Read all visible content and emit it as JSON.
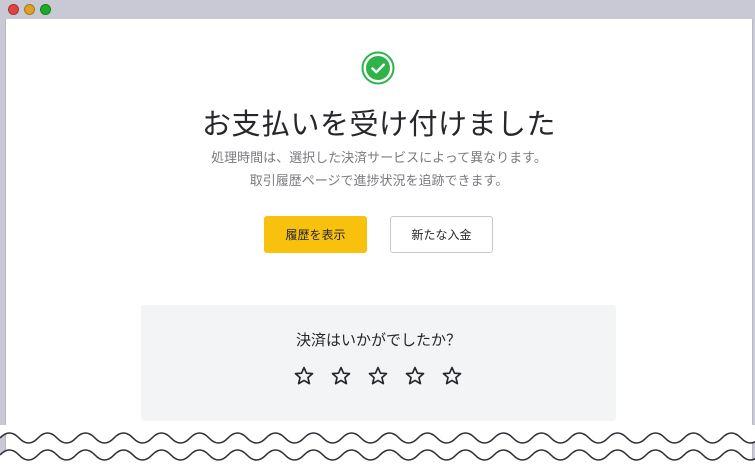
{
  "window": {
    "controls": [
      "close",
      "minimize",
      "zoom"
    ]
  },
  "confirmation": {
    "icon": "check-circle-icon",
    "heading": "お支払いを受け付けました",
    "line1": "処理時間は、選択した決済サービスによって異なります。",
    "line2": "取引履歴ページで進捗状況を追跡できます。"
  },
  "actions": {
    "history_label": "履歴を表示",
    "new_deposit_label": "新たな入金"
  },
  "feedback": {
    "question": "決済はいかがでしたか？",
    "rating_max": 5,
    "rating_value": 0
  },
  "colors": {
    "accent": "#f7c10d",
    "success": "#2db34a",
    "panel": "#f3f4f6"
  }
}
